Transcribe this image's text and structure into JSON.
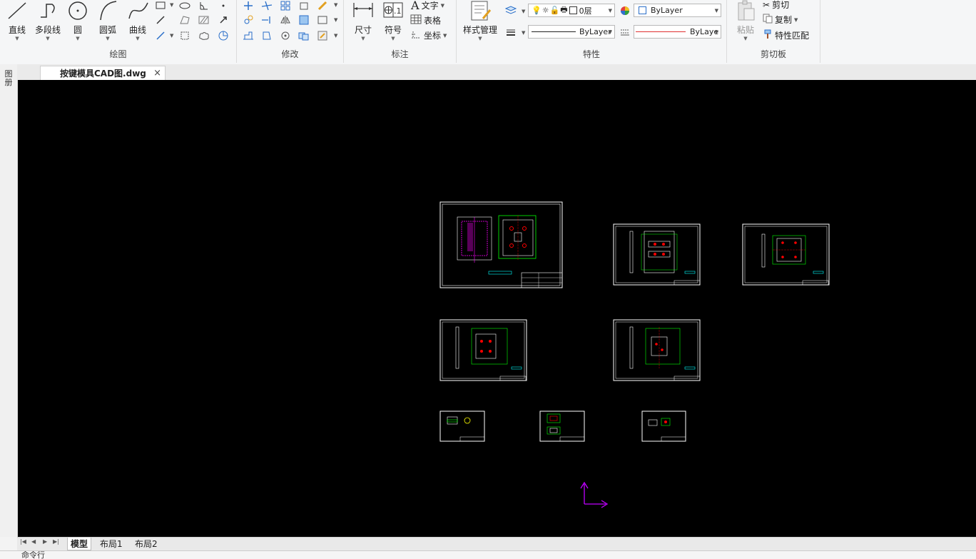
{
  "ribbon": {
    "draw": {
      "title": "绘图",
      "line_label": "直线",
      "polyline_label": "多段线",
      "circle_label": "圆",
      "arc_label": "圆弧",
      "spline_label": "曲线"
    },
    "modify": {
      "title": "修改"
    },
    "annotate": {
      "title": "标注",
      "dimension_label": "尺寸",
      "symbol_label": "符号",
      "text_label": "文字",
      "table_label": "表格",
      "coordinate_label": "坐标"
    },
    "properties": {
      "title": "特性",
      "style_manager_label": "样式管理",
      "layer_value": "0层",
      "color_value": "ByLayer",
      "linetype_value": "ByLayer",
      "lineweight_value": "ByLaye"
    },
    "clipboard": {
      "title": "剪切板",
      "paste_label": "粘贴",
      "cut_label": "剪切",
      "copy_label": "复制",
      "match_label": "特性匹配"
    }
  },
  "document": {
    "tab_title": "按键模具CAD图.dwg",
    "close_glyph": "×"
  },
  "left_panel": {
    "label": "图册"
  },
  "layout_tabs": [
    "模型",
    "布局1",
    "布局2"
  ],
  "command_line": {
    "prompt": "命令行"
  },
  "colors": {
    "canvas_bg": "#000000",
    "cad_white": "#ffffff",
    "cad_green": "#00ff00",
    "cad_magenta": "#ff00ff",
    "cad_red": "#ff0000",
    "cad_cyan": "#00ffff",
    "ucs_color": "#c000ff"
  }
}
